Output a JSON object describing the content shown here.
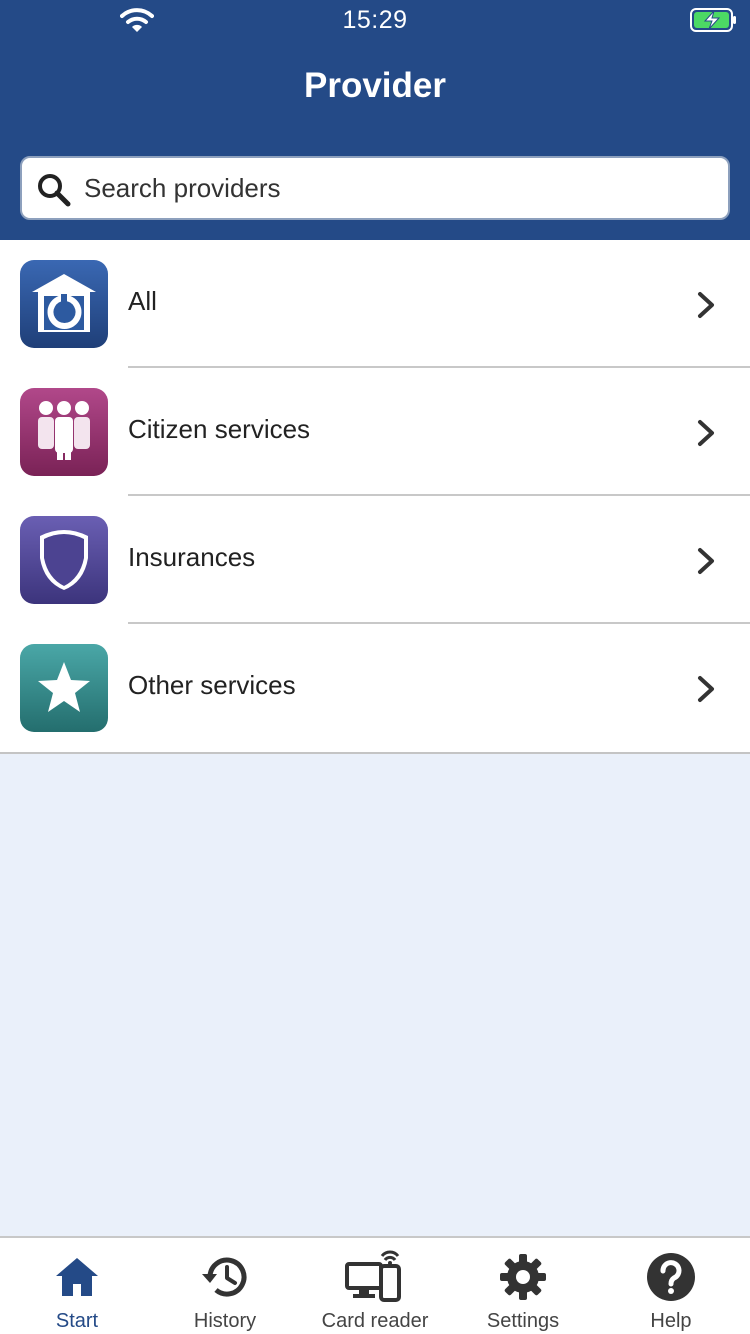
{
  "status_bar": {
    "time": "15:29"
  },
  "header": {
    "title": "Provider"
  },
  "search": {
    "placeholder": "Search providers"
  },
  "categories": [
    {
      "label": "All",
      "icon": "home-provider-icon",
      "color": "#244a87"
    },
    {
      "label": "Citizen services",
      "icon": "people-icon",
      "color": "#8c2b64"
    },
    {
      "label": "Insurances",
      "icon": "shield-icon",
      "color": "#4c4391"
    },
    {
      "label": "Other services",
      "icon": "star-icon",
      "color": "#2f8a8a"
    }
  ],
  "tabs": [
    {
      "label": "Start",
      "icon": "home-icon",
      "active": true
    },
    {
      "label": "History",
      "icon": "history-icon",
      "active": false
    },
    {
      "label": "Card reader",
      "icon": "card-reader-icon",
      "active": false
    },
    {
      "label": "Settings",
      "icon": "gear-icon",
      "active": false
    },
    {
      "label": "Help",
      "icon": "help-icon",
      "active": false
    }
  ],
  "colors": {
    "primary": "#244a87",
    "background": "#eaf0fa",
    "battery": "#4cd964"
  }
}
